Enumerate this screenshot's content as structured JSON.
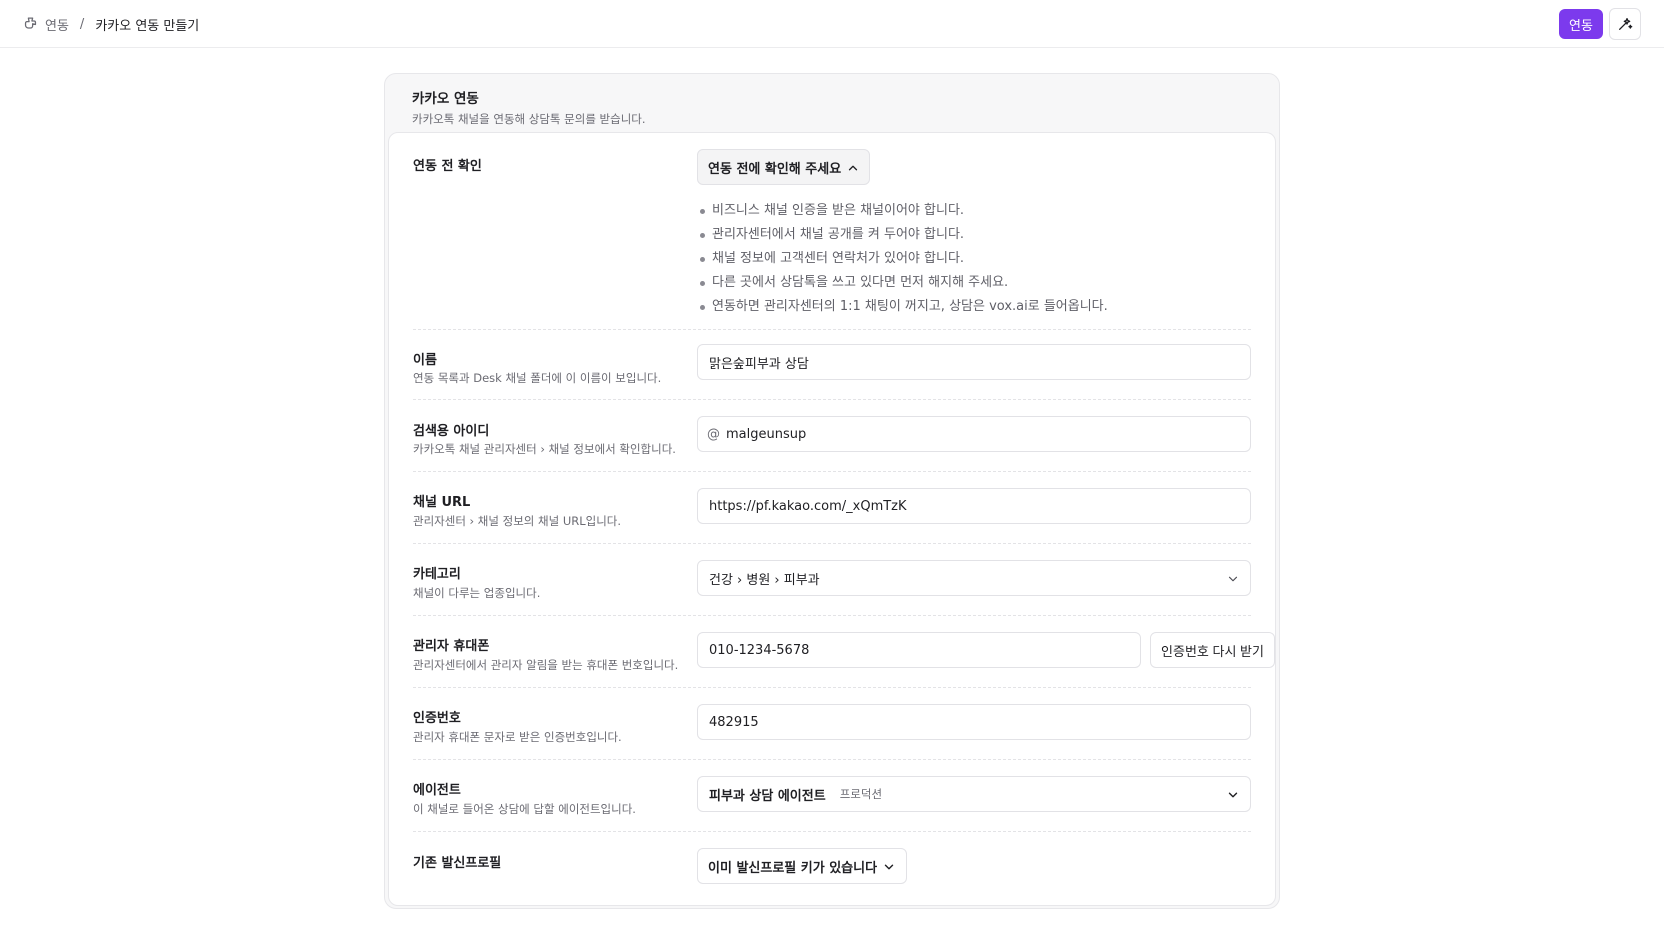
{
  "breadcrumb": {
    "root": "연동",
    "separator": "/",
    "current": "카카오 연동 만들기"
  },
  "header": {
    "primary_button": "연동"
  },
  "card": {
    "title": "카카오 연동",
    "subtitle": "카카오톡 채널을 연동해 상담톡 문의를 받습니다."
  },
  "precheck": {
    "label": "연동 전 확인",
    "toggle": "연동 전에 확인해 주세요",
    "items": [
      "비즈니스 채널 인증을 받은 채널이어야 합니다.",
      "관리자센터에서 채널 공개를 켜 두어야 합니다.",
      "채널 정보에 고객센터 연락처가 있어야 합니다.",
      "다른 곳에서 상담톡을 쓰고 있다면 먼저 해지해 주세요.",
      "연동하면 관리자센터의 1:1 채팅이 꺼지고, 상담은 vox.ai로 들어옵니다."
    ]
  },
  "name": {
    "label": "이름",
    "desc": "연동 목록과 Desk 채널 폴더에 이 이름이 보입니다.",
    "value": "맑은숲피부과 상담"
  },
  "search_id": {
    "label": "검색용 아이디",
    "desc": "카카오톡 채널 관리자센터 › 채널 정보에서 확인합니다.",
    "prefix": "@",
    "value": "malgeunsup"
  },
  "channel_url": {
    "label": "채널 URL",
    "desc": "관리자센터 › 채널 정보의 채널 URL입니다.",
    "value": "https://pf.kakao.com/_xQmTzK"
  },
  "category": {
    "label": "카테고리",
    "desc": "채널이 다루는 업종입니다.",
    "value": "건강 › 병원 › 피부과"
  },
  "admin_phone": {
    "label": "관리자 휴대폰",
    "desc": "관리자센터에서 관리자 알림을 받는 휴대폰 번호입니다.",
    "value": "010-1234-5678",
    "resend": "인증번호 다시 받기"
  },
  "verify_code": {
    "label": "인증번호",
    "desc": "관리자 휴대폰 문자로 받은 인증번호입니다.",
    "value": "482915"
  },
  "agent": {
    "label": "에이전트",
    "desc": "이 채널로 들어온 상담에 답할 에이전트입니다.",
    "value": "피부과 상담 에이전트",
    "badge": "프로덕션"
  },
  "sender_profile": {
    "label": "기존 발신프로필",
    "value": "이미 발신프로필 키가 있습니다"
  },
  "colors": {
    "accent": "#7c3aed",
    "border": "#e2e2e6",
    "muted": "#6b6b73"
  }
}
